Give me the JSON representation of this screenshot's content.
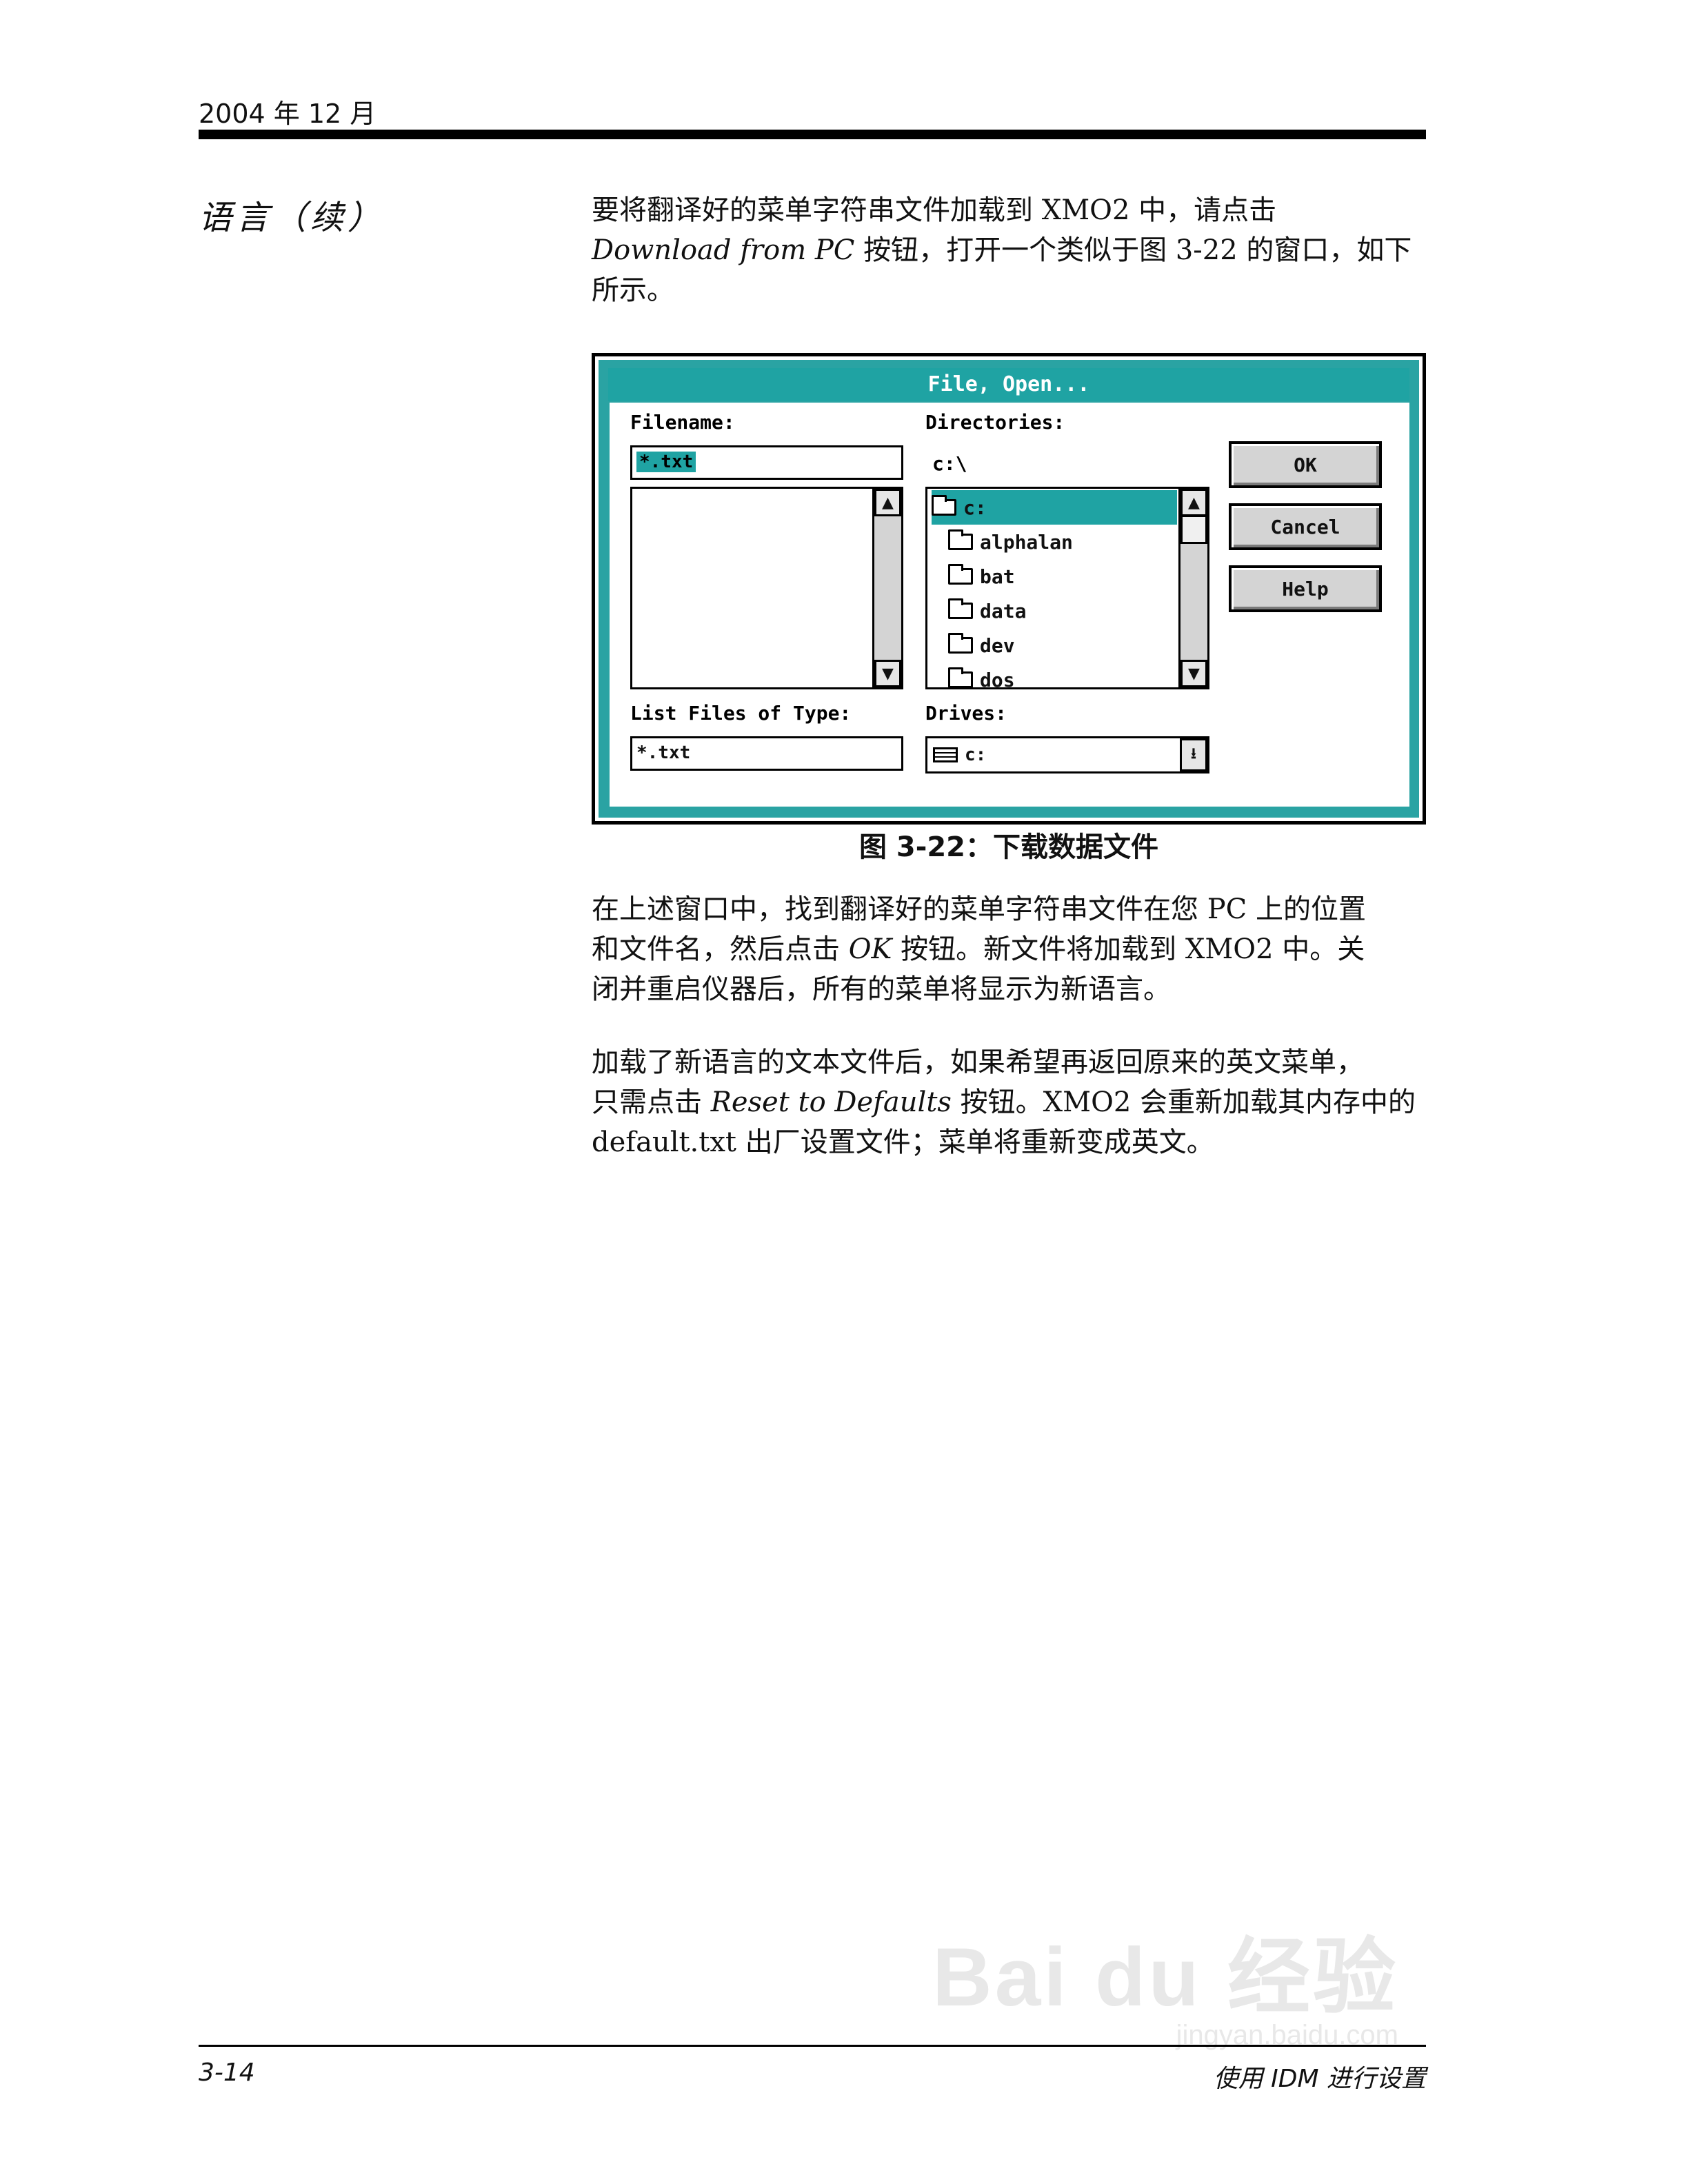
{
  "header": {
    "date": "2004 年 12 月"
  },
  "side_heading": "语言（续）",
  "para1": {
    "l1a": "要将翻译好的菜单字符串文件加载到 ",
    "l1b": "XMO2",
    "l1c": " 中，请点击",
    "l2a": "Download from PC",
    "l2b": " 按钮，打开一个类似于图 ",
    "l2c": "3-22",
    "l2d": " 的窗口，如下",
    "l3": "所示。"
  },
  "dialog": {
    "title": "File, Open...",
    "filename_label": "Filename:",
    "filename_value": "*.txt",
    "directories_label": "Directories:",
    "current_dir": "c:\\",
    "dir_items": [
      "c:",
      "alphalan",
      "bat",
      "data",
      "dev",
      "dos"
    ],
    "list_type_label": "List Files of Type:",
    "list_type_value": "*.txt",
    "drives_label": "Drives:",
    "drive_value": "c:",
    "ok": "OK",
    "cancel": "Cancel",
    "help": "Help"
  },
  "caption": "图 3-22：下载数据文件",
  "para2": {
    "l1a": "在上述窗口中，找到翻译好的菜单字符串文件在您 ",
    "l1b": "PC",
    "l1c": " 上的位置",
    "l2a": "和文件名，然后点击 ",
    "l2b": "OK",
    "l2c": " 按钮。新文件将加载到 ",
    "l2d": "XMO2",
    "l2e": " 中。关",
    "l3": "闭并重启仪器后，所有的菜单将显示为新语言。"
  },
  "para3": {
    "l1": "加载了新语言的文本文件后，如果希望再返回原来的英文菜单，",
    "l2a": "只需点击 ",
    "l2b": "Reset to Defaults",
    "l2c": " 按钮。",
    "l2d": "XMO2",
    "l2e": " 会重新加载其内存中的",
    "l3a": "default.txt",
    "l3b": " 出厂设置文件；菜单将重新变成英文。"
  },
  "footer": {
    "page": "3-14",
    "section": "使用 IDM 进行设置"
  },
  "watermark": {
    "brand": "Bai du 经验",
    "url": "jingyan.baidu.com"
  }
}
